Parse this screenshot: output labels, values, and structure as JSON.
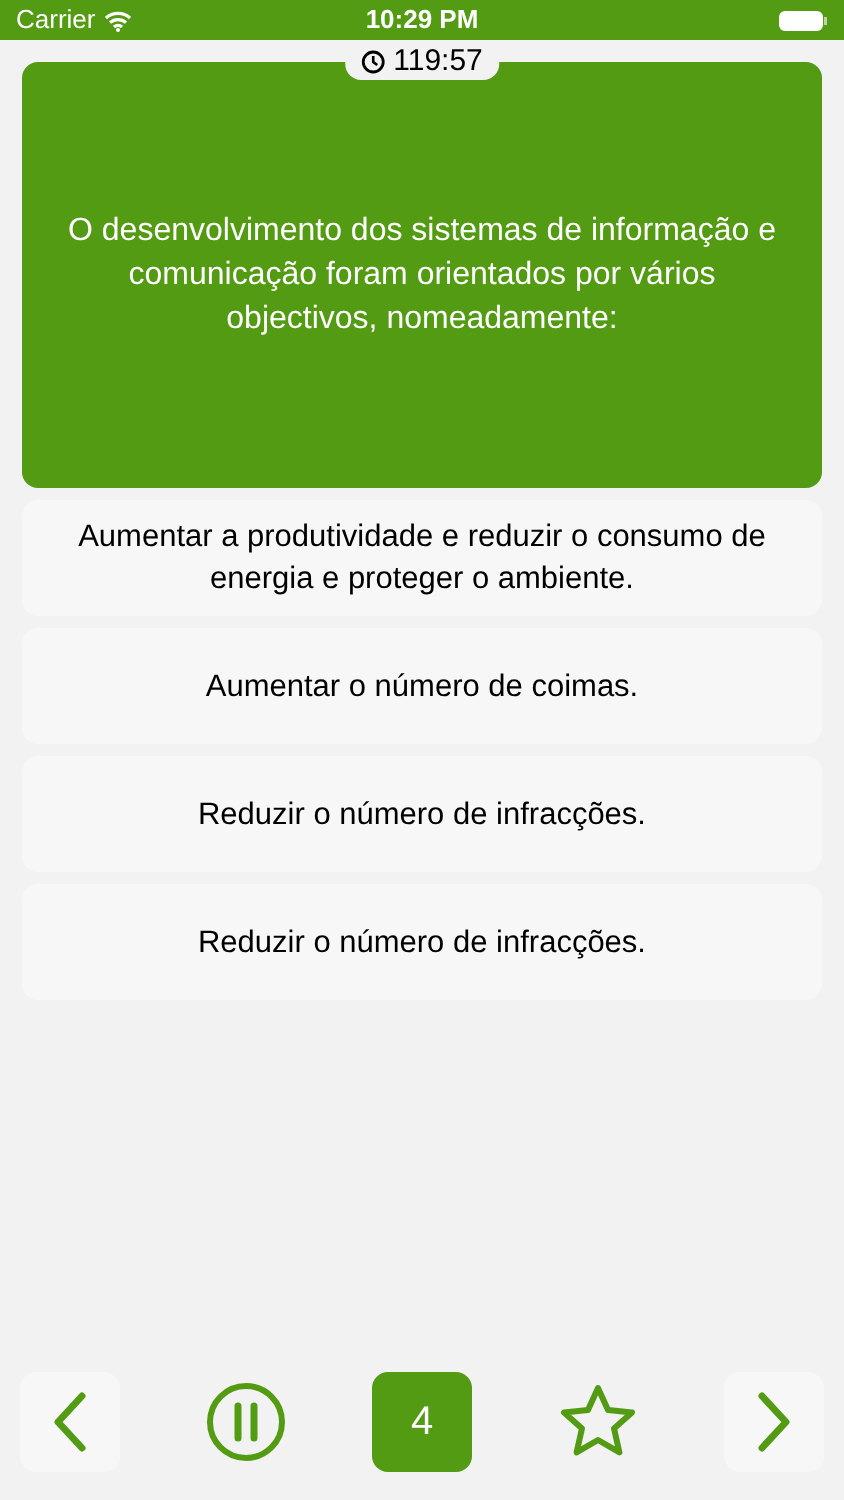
{
  "status_bar": {
    "carrier": "Carrier",
    "time": "10:29 PM"
  },
  "timer": "119:57",
  "question": "O desenvolvimento dos sistemas de informação e comunicação foram orientados por vários objectivos, nomeadamente:",
  "answers": [
    {
      "text": "Aumentar a produtividade e reduzir o consumo de energia e proteger o ambiente."
    },
    {
      "text": "Aumentar o número de coimas."
    },
    {
      "text": "Reduzir o número de infracções."
    },
    {
      "text": "Reduzir o número de infracções."
    }
  ],
  "toolbar": {
    "question_number": "4",
    "favorited": false
  }
}
